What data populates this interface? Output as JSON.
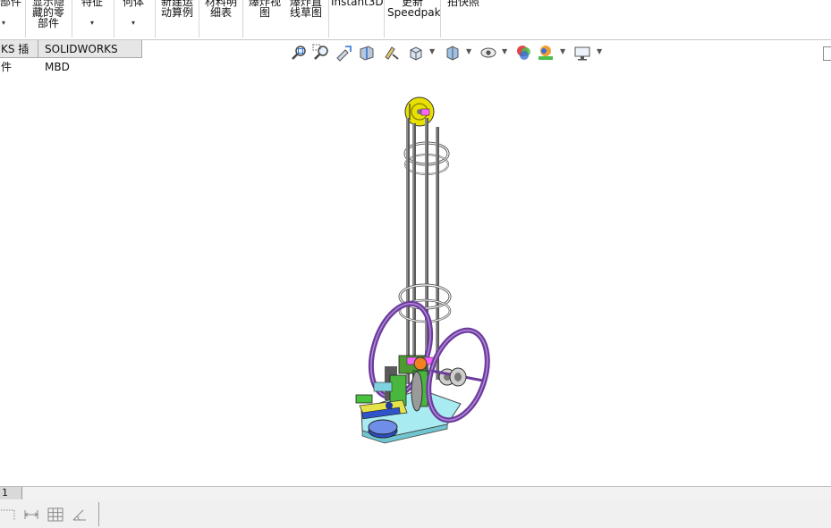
{
  "ribbon": {
    "items": [
      {
        "lines": [
          "部件"
        ],
        "arrow": "▾"
      },
      {
        "lines": [
          "显示隐",
          "藏的零",
          "部件"
        ],
        "arrow": ""
      },
      {
        "lines": [
          "特征"
        ],
        "arrow": "▾"
      },
      {
        "lines": [
          "何体"
        ],
        "arrow": "▾"
      },
      {
        "lines": [
          "新建运",
          "动算例"
        ],
        "arrow": ""
      },
      {
        "lines": [
          "材料明",
          "细表"
        ],
        "arrow": ""
      },
      {
        "lines": [
          "爆炸视",
          "图"
        ],
        "arrow": ""
      },
      {
        "lines": [
          "爆炸直",
          "线草图"
        ],
        "arrow": ""
      },
      {
        "lines": [
          "Instant3D"
        ],
        "arrow": ""
      },
      {
        "lines": [
          "更新",
          "Speedpak"
        ],
        "arrow": ""
      },
      {
        "lines": [
          "拍快照"
        ],
        "arrow": ""
      }
    ]
  },
  "tabs": {
    "addins": "KS 插件",
    "mbd": "SOLIDWORKS MBD"
  },
  "hud_icons": [
    "zoom-to-fit-icon",
    "zoom-to-area-icon",
    "previous-view-icon",
    "section-view-icon",
    "dynamic-annotation-icon",
    "view-orientation-icon",
    "display-style-icon",
    "hide-show-items-icon",
    "edit-appearance-icon",
    "apply-scene-icon",
    "view-settings-icon"
  ],
  "sheet": {
    "tab_label": "1"
  },
  "colors": {
    "purple": "#7b3fa8",
    "yellow": "#e8e000",
    "cyan": "#9fe6ee",
    "green": "#35b535",
    "blue": "#3355cc",
    "gray": "#6f6f6f"
  }
}
